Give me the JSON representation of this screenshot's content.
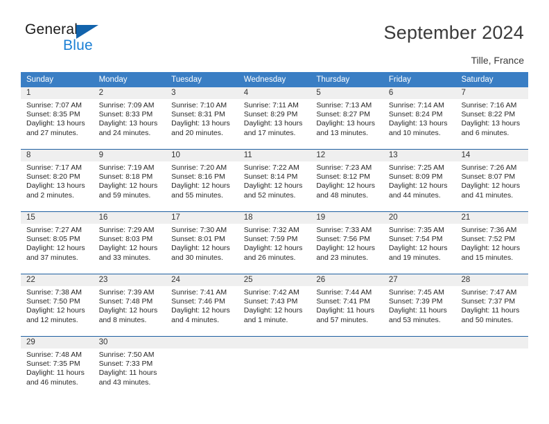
{
  "brand": {
    "name_part1": "General",
    "name_part2": "Blue",
    "accent_color": "#1263ac",
    "blue_text_color": "#1b7fd4"
  },
  "header": {
    "title": "September 2024",
    "location": "Tille, France"
  },
  "calendar": {
    "header_bg": "#3a7ec4",
    "row_divider": "#1c5ea0",
    "day_band_bg": "#efefef",
    "weekdays": [
      "Sunday",
      "Monday",
      "Tuesday",
      "Wednesday",
      "Thursday",
      "Friday",
      "Saturday"
    ],
    "weeks": [
      [
        {
          "day": "1",
          "sunrise": "Sunrise: 7:07 AM",
          "sunset": "Sunset: 8:35 PM",
          "daylight": "Daylight: 13 hours and 27 minutes."
        },
        {
          "day": "2",
          "sunrise": "Sunrise: 7:09 AM",
          "sunset": "Sunset: 8:33 PM",
          "daylight": "Daylight: 13 hours and 24 minutes."
        },
        {
          "day": "3",
          "sunrise": "Sunrise: 7:10 AM",
          "sunset": "Sunset: 8:31 PM",
          "daylight": "Daylight: 13 hours and 20 minutes."
        },
        {
          "day": "4",
          "sunrise": "Sunrise: 7:11 AM",
          "sunset": "Sunset: 8:29 PM",
          "daylight": "Daylight: 13 hours and 17 minutes."
        },
        {
          "day": "5",
          "sunrise": "Sunrise: 7:13 AM",
          "sunset": "Sunset: 8:27 PM",
          "daylight": "Daylight: 13 hours and 13 minutes."
        },
        {
          "day": "6",
          "sunrise": "Sunrise: 7:14 AM",
          "sunset": "Sunset: 8:24 PM",
          "daylight": "Daylight: 13 hours and 10 minutes."
        },
        {
          "day": "7",
          "sunrise": "Sunrise: 7:16 AM",
          "sunset": "Sunset: 8:22 PM",
          "daylight": "Daylight: 13 hours and 6 minutes."
        }
      ],
      [
        {
          "day": "8",
          "sunrise": "Sunrise: 7:17 AM",
          "sunset": "Sunset: 8:20 PM",
          "daylight": "Daylight: 13 hours and 2 minutes."
        },
        {
          "day": "9",
          "sunrise": "Sunrise: 7:19 AM",
          "sunset": "Sunset: 8:18 PM",
          "daylight": "Daylight: 12 hours and 59 minutes."
        },
        {
          "day": "10",
          "sunrise": "Sunrise: 7:20 AM",
          "sunset": "Sunset: 8:16 PM",
          "daylight": "Daylight: 12 hours and 55 minutes."
        },
        {
          "day": "11",
          "sunrise": "Sunrise: 7:22 AM",
          "sunset": "Sunset: 8:14 PM",
          "daylight": "Daylight: 12 hours and 52 minutes."
        },
        {
          "day": "12",
          "sunrise": "Sunrise: 7:23 AM",
          "sunset": "Sunset: 8:12 PM",
          "daylight": "Daylight: 12 hours and 48 minutes."
        },
        {
          "day": "13",
          "sunrise": "Sunrise: 7:25 AM",
          "sunset": "Sunset: 8:09 PM",
          "daylight": "Daylight: 12 hours and 44 minutes."
        },
        {
          "day": "14",
          "sunrise": "Sunrise: 7:26 AM",
          "sunset": "Sunset: 8:07 PM",
          "daylight": "Daylight: 12 hours and 41 minutes."
        }
      ],
      [
        {
          "day": "15",
          "sunrise": "Sunrise: 7:27 AM",
          "sunset": "Sunset: 8:05 PM",
          "daylight": "Daylight: 12 hours and 37 minutes."
        },
        {
          "day": "16",
          "sunrise": "Sunrise: 7:29 AM",
          "sunset": "Sunset: 8:03 PM",
          "daylight": "Daylight: 12 hours and 33 minutes."
        },
        {
          "day": "17",
          "sunrise": "Sunrise: 7:30 AM",
          "sunset": "Sunset: 8:01 PM",
          "daylight": "Daylight: 12 hours and 30 minutes."
        },
        {
          "day": "18",
          "sunrise": "Sunrise: 7:32 AM",
          "sunset": "Sunset: 7:59 PM",
          "daylight": "Daylight: 12 hours and 26 minutes."
        },
        {
          "day": "19",
          "sunrise": "Sunrise: 7:33 AM",
          "sunset": "Sunset: 7:56 PM",
          "daylight": "Daylight: 12 hours and 23 minutes."
        },
        {
          "day": "20",
          "sunrise": "Sunrise: 7:35 AM",
          "sunset": "Sunset: 7:54 PM",
          "daylight": "Daylight: 12 hours and 19 minutes."
        },
        {
          "day": "21",
          "sunrise": "Sunrise: 7:36 AM",
          "sunset": "Sunset: 7:52 PM",
          "daylight": "Daylight: 12 hours and 15 minutes."
        }
      ],
      [
        {
          "day": "22",
          "sunrise": "Sunrise: 7:38 AM",
          "sunset": "Sunset: 7:50 PM",
          "daylight": "Daylight: 12 hours and 12 minutes."
        },
        {
          "day": "23",
          "sunrise": "Sunrise: 7:39 AM",
          "sunset": "Sunset: 7:48 PM",
          "daylight": "Daylight: 12 hours and 8 minutes."
        },
        {
          "day": "24",
          "sunrise": "Sunrise: 7:41 AM",
          "sunset": "Sunset: 7:46 PM",
          "daylight": "Daylight: 12 hours and 4 minutes."
        },
        {
          "day": "25",
          "sunrise": "Sunrise: 7:42 AM",
          "sunset": "Sunset: 7:43 PM",
          "daylight": "Daylight: 12 hours and 1 minute."
        },
        {
          "day": "26",
          "sunrise": "Sunrise: 7:44 AM",
          "sunset": "Sunset: 7:41 PM",
          "daylight": "Daylight: 11 hours and 57 minutes."
        },
        {
          "day": "27",
          "sunrise": "Sunrise: 7:45 AM",
          "sunset": "Sunset: 7:39 PM",
          "daylight": "Daylight: 11 hours and 53 minutes."
        },
        {
          "day": "28",
          "sunrise": "Sunrise: 7:47 AM",
          "sunset": "Sunset: 7:37 PM",
          "daylight": "Daylight: 11 hours and 50 minutes."
        }
      ],
      [
        {
          "day": "29",
          "sunrise": "Sunrise: 7:48 AM",
          "sunset": "Sunset: 7:35 PM",
          "daylight": "Daylight: 11 hours and 46 minutes."
        },
        {
          "day": "30",
          "sunrise": "Sunrise: 7:50 AM",
          "sunset": "Sunset: 7:33 PM",
          "daylight": "Daylight: 11 hours and 43 minutes."
        },
        {
          "day": "",
          "sunrise": "",
          "sunset": "",
          "daylight": ""
        },
        {
          "day": "",
          "sunrise": "",
          "sunset": "",
          "daylight": ""
        },
        {
          "day": "",
          "sunrise": "",
          "sunset": "",
          "daylight": ""
        },
        {
          "day": "",
          "sunrise": "",
          "sunset": "",
          "daylight": ""
        },
        {
          "day": "",
          "sunrise": "",
          "sunset": "",
          "daylight": ""
        }
      ]
    ]
  }
}
